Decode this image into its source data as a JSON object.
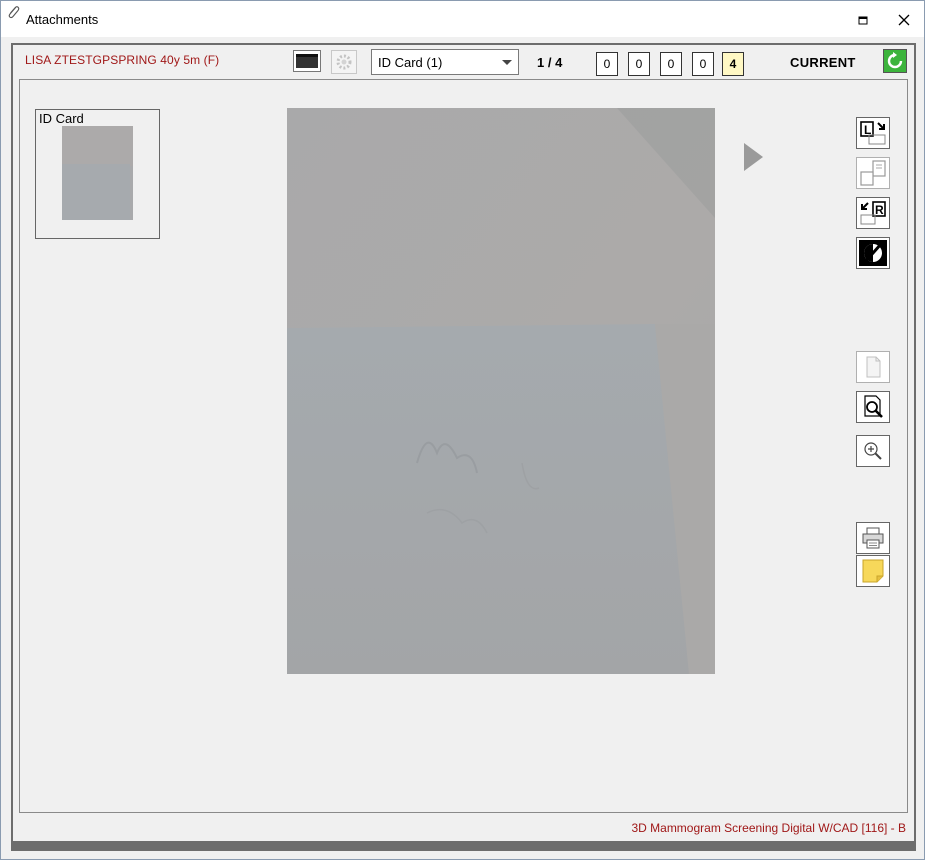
{
  "window": {
    "title": "Attachments"
  },
  "patient": {
    "label": "LISA ZTESTGPSPRING  40y 5m (F)"
  },
  "document_select": {
    "selected": "ID Card (1)"
  },
  "pager": {
    "text": "1 / 4"
  },
  "counts": [
    "0",
    "0",
    "0",
    "0",
    "4"
  ],
  "status": {
    "label": "CURRENT"
  },
  "thumbnail": {
    "label": "ID Card"
  },
  "footer": {
    "exam": "3D Mammogram Screening Digital W/CAD [116] - B"
  },
  "colors": {
    "patient_text": "#a01818",
    "highlight_box": "#fff8c4",
    "refresh_green": "#2aa02a"
  }
}
